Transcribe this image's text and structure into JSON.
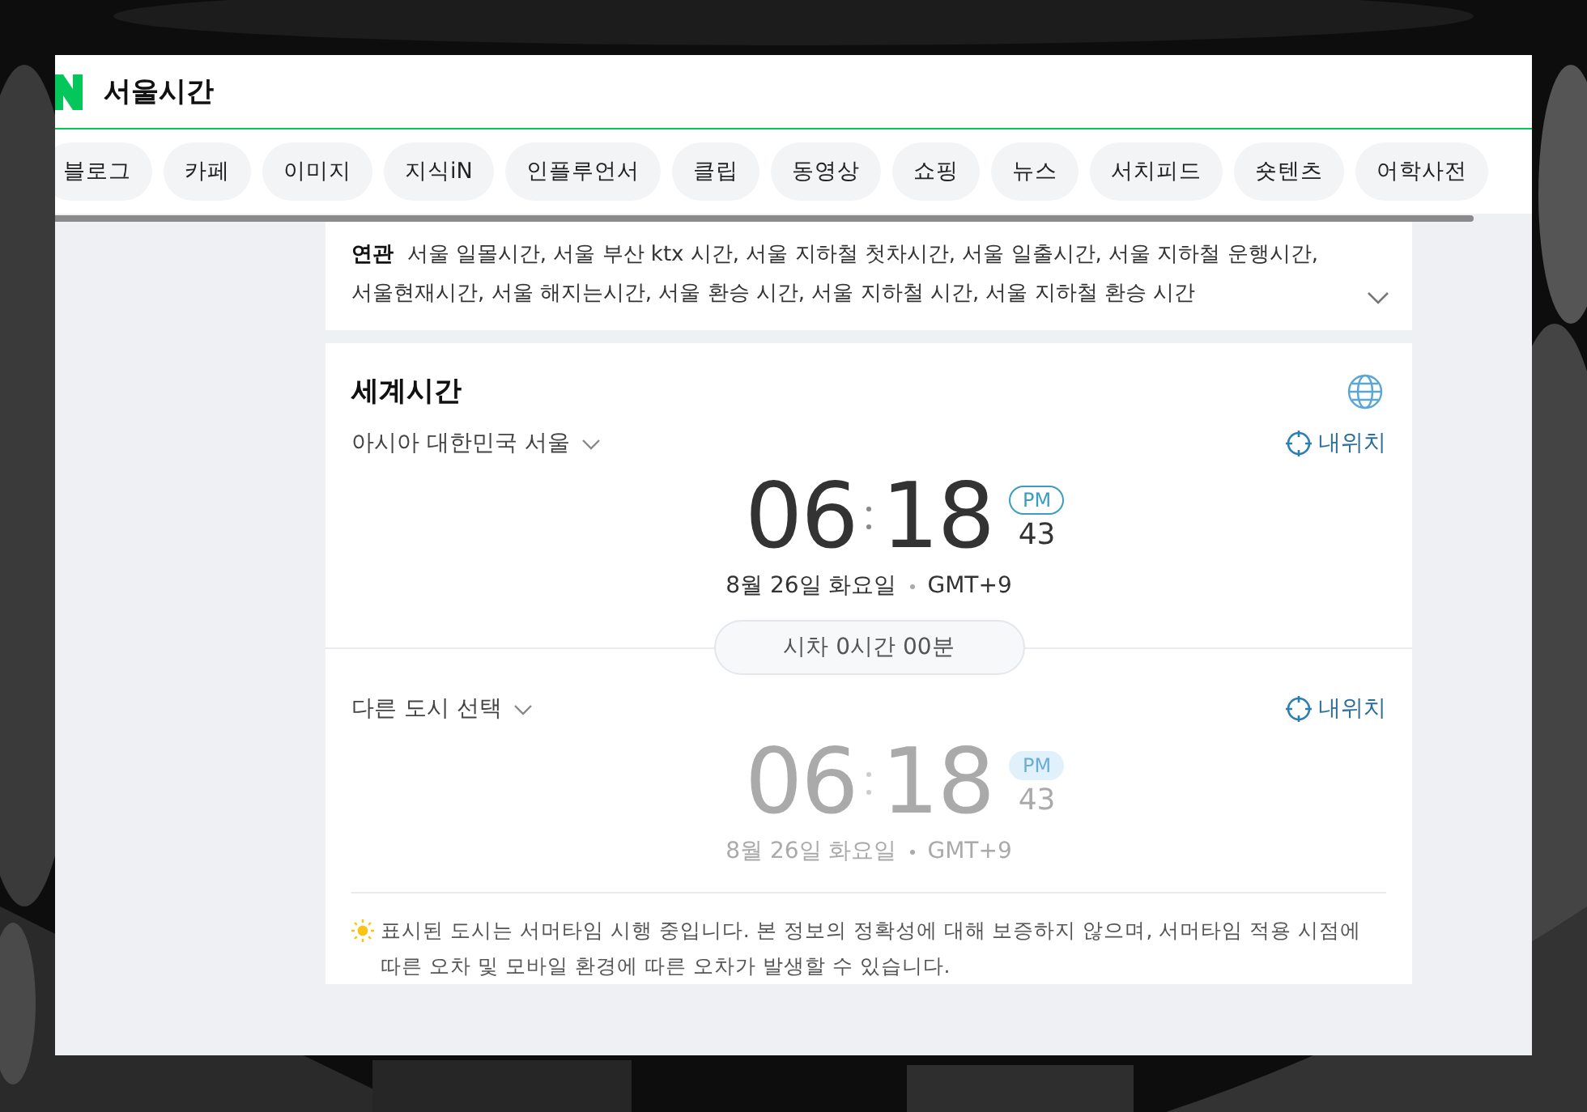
{
  "header": {
    "title": "서울시간"
  },
  "tabs": [
    {
      "label": "블로그",
      "selected": false
    },
    {
      "label": "카페",
      "selected": false
    },
    {
      "label": "이미지",
      "selected": false
    },
    {
      "label": "지식iN",
      "selected": false
    },
    {
      "label": "인플루언서",
      "selected": false
    },
    {
      "label": "클립",
      "selected": false
    },
    {
      "label": "동영상",
      "selected": false
    },
    {
      "label": "쇼핑",
      "selected": false
    },
    {
      "label": "뉴스",
      "selected": false
    },
    {
      "label": "서치피드",
      "selected": false
    },
    {
      "label": "숏텐츠",
      "selected": false
    },
    {
      "label": "어학사전",
      "selected": false
    }
  ],
  "related": {
    "label": "연관",
    "text": "서울 일몰시간, 서울 부산 ktx 시간, 서울 지하철 첫차시간, 서울 일출시간, 서울 지하철 운행시간, 서울현재시간, 서울 해지는시간, 서울 환승 시간, 서울 지하철 시간, 서울 지하철 환승 시간"
  },
  "world_time": {
    "title": "세계시간",
    "clocks": [
      {
        "city": "아시아 대한민국 서울",
        "locate": "내위치",
        "hour": "06",
        "minute": "18",
        "ampm": "PM",
        "second": "43",
        "date": "8월 26일 화요일",
        "zone": "GMT+9",
        "active": true
      },
      {
        "city": "다른 도시 선택",
        "locate": "내위치",
        "hour": "06",
        "minute": "18",
        "ampm": "PM",
        "second": "43",
        "date": "8월 26일 화요일",
        "zone": "GMT+9",
        "active": false
      }
    ],
    "difference": "시차 0시간 00분",
    "notice": "표시된 도시는 서머타임 시행 중입니다. 본 정보의 정확성에 대해 보증하지 않으며, 서머타임 적용 시점에 따른 오차 및 모바일 환경에 따른 오차가 발생할 수 있습니다."
  }
}
